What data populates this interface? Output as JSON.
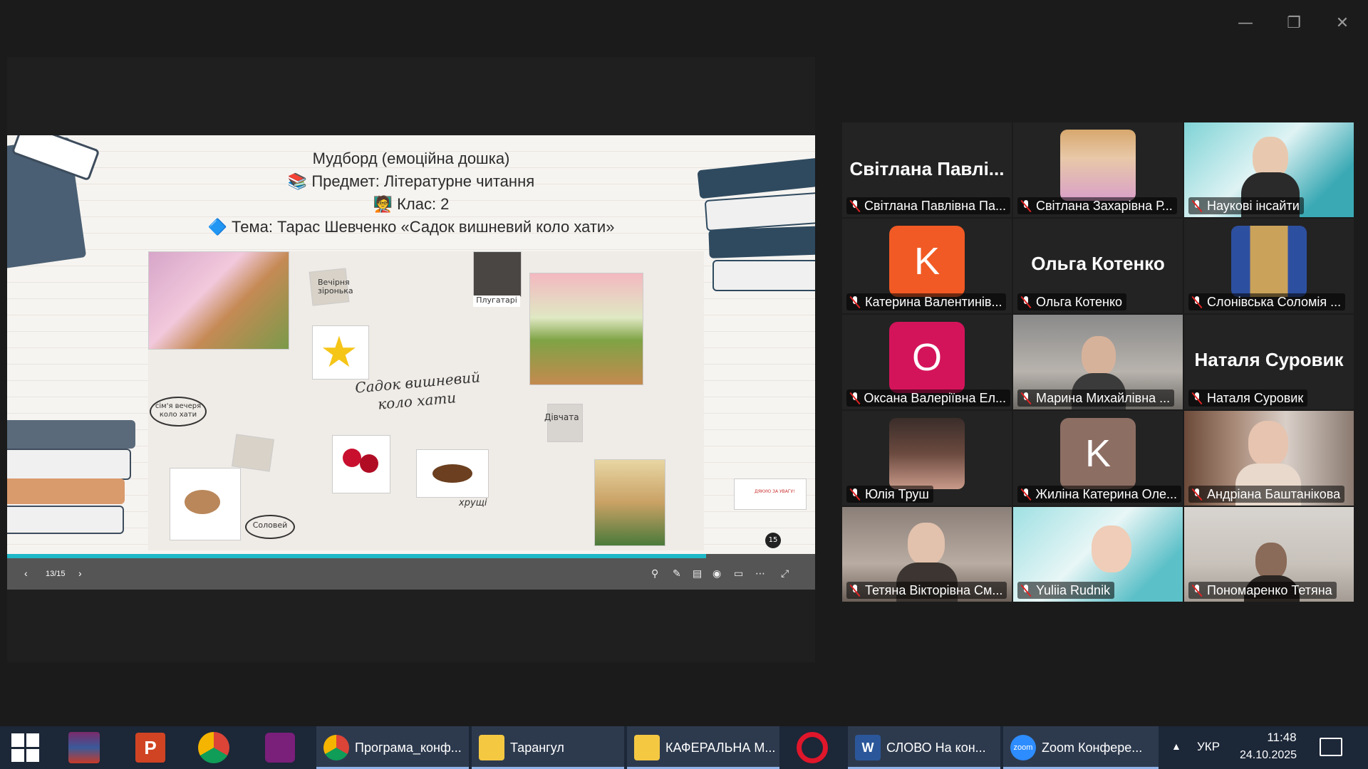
{
  "window": {
    "minimize_icon": "minimize-icon",
    "restore_icon": "restore-icon",
    "close_icon": "close-icon"
  },
  "slide": {
    "title_line1": "Мудборд (емоційна дошка)",
    "title_line2": "📚 Предмет: Літературне читання",
    "title_line3": "🧑‍🏫 Клас: 2",
    "title_line4": "🔷 Тема: Тарас Шевченко «Садок вишневий коло хати»",
    "board": {
      "center_text_1": "Садок вишневий",
      "center_text_2": "коло хати",
      "label_evening": "сім'я вечеря коло хати",
      "label_star": "Вечірня зіронька",
      "label_plowmen": "Плугатарі",
      "label_girls": "Дівчата",
      "label_nightingale": "Соловей",
      "label_beetles": "хрущі"
    },
    "thumb_text": "ДЯКУЮ ЗА УВАГУ!",
    "thumb_badge": "15"
  },
  "controls": {
    "page_counter": "13/15",
    "prev_icon": "chevron-left-icon",
    "next_icon": "chevron-right-icon",
    "progress_fraction": 0.865
  },
  "participants": [
    {
      "label": "Світлана Павлівна Па...",
      "display_name": "Світлана  Павлі..."
    },
    {
      "label": "Світлана Захарівна Р..."
    },
    {
      "label": "Наукові інсайти"
    },
    {
      "label": "Катерина Валентинів...",
      "initial": "K"
    },
    {
      "label": "Ольга Котенко",
      "display_name": "Ольга Котенко"
    },
    {
      "label": "Слонівська Соломія ..."
    },
    {
      "label": "Оксана Валеріївна Ел...",
      "initial": "O"
    },
    {
      "label": "Марина Михайлівна ..."
    },
    {
      "label": "Наталя Суровик",
      "display_name": "Наталя Суровик"
    },
    {
      "label": "Юлія Труш"
    },
    {
      "label": "Жиліна Катерина Оле...",
      "initial": "K"
    },
    {
      "label": "Андріана Баштанікова"
    },
    {
      "label": "Тетяна Вікторівна См..."
    },
    {
      "label": "Yuliia Rudnik"
    },
    {
      "label": "Пономаренко Тетяна"
    }
  ],
  "colors": {
    "avatar_orange": "#f15a24",
    "avatar_magenta": "#d4145a",
    "avatar_brown": "#8d6e63",
    "active_speaker": "#23d18b",
    "muted": "#e02424"
  },
  "taskbar": {
    "apps": [
      {
        "label": "Програма_конф..."
      },
      {
        "label": "Тарангул"
      },
      {
        "label": "КАФЕРАЛЬНА М..."
      },
      {
        "label": "СЛОВО На кон..."
      },
      {
        "label": "Zoom Конфере..."
      }
    ],
    "zoom_icon_text": "zoom",
    "lang": "УКР",
    "time": "11:48",
    "date": "24.10.2025"
  }
}
